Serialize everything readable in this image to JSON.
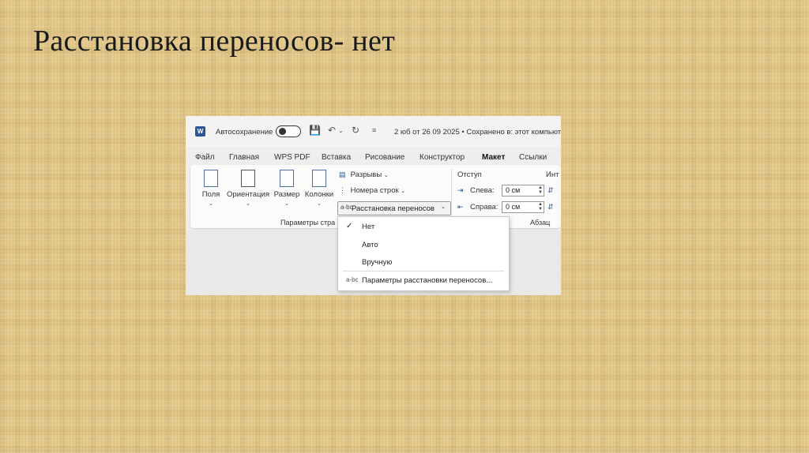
{
  "slide": {
    "title": "Расстановка переносов- нет"
  },
  "titlebar": {
    "app_icon": "word-icon",
    "app_letter": "W",
    "autosave_label": "Автосохранение",
    "autosave_state": "off",
    "file_status": "2 юб от 26 09 2025 • Сохранено в: этот компьют"
  },
  "tabs": [
    "Файл",
    "Главная",
    "WPS PDF",
    "Вставка",
    "Рисование",
    "Конструктор",
    "Макет",
    "Ссылки"
  ],
  "active_tab": "Макет",
  "ribbon": {
    "margins": "Поля",
    "orientation": "Ориентация",
    "size": "Размер",
    "columns": "Колонки",
    "breaks": "Разрывы",
    "line_numbers": "Номера строк",
    "hyphenation": "Расстановка переносов",
    "page_setup_group": "Параметры стра",
    "indent_header": "Отступ",
    "interval_header": "Инт",
    "left_label": "Слева:",
    "right_label": "Справа:",
    "left_value": "0 см",
    "right_value": "0 см",
    "paragraph_group": "Абзац"
  },
  "menu": {
    "none": "Нет",
    "auto": "Авто",
    "manual": "Вручную",
    "options": "Параметры расстановки переносов...",
    "selected": "Нет"
  },
  "colors": {
    "accent": "#2b579a",
    "background": "#e2c98c"
  }
}
